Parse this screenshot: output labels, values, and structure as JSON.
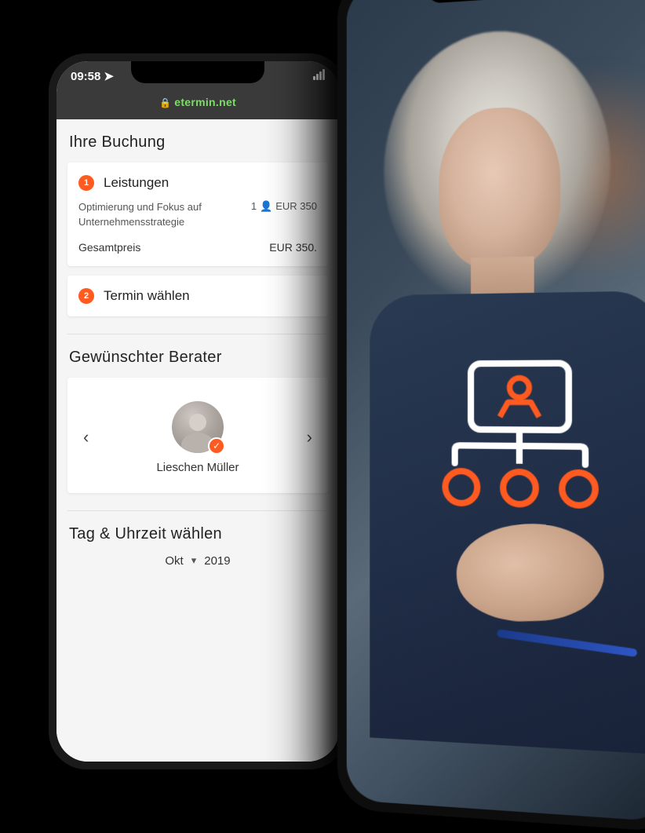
{
  "status": {
    "time": "09:58",
    "domain": "etermin.net"
  },
  "booking": {
    "heading": "Ihre Buchung",
    "step1": {
      "num": "1",
      "title": "Leistungen",
      "item_desc": "Optimierung und Fokus auf Unternehmensstrategie",
      "item_qty": "1",
      "item_price": "EUR 350",
      "total_label": "Gesamtpreis",
      "total_value": "EUR 350."
    },
    "step2": {
      "num": "2",
      "title": "Termin wählen"
    }
  },
  "consultant": {
    "heading": "Gewünschter Berater",
    "name": "Lieschen Müller"
  },
  "datetime": {
    "heading": "Tag & Uhrzeit wählen",
    "month": "Okt",
    "year": "2019"
  }
}
